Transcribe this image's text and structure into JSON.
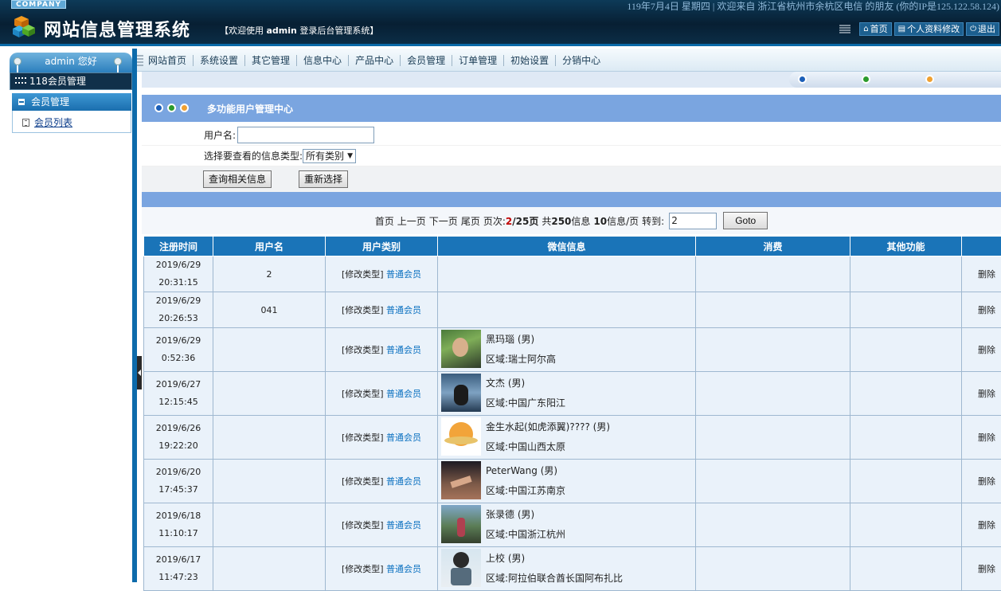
{
  "header": {
    "company": "COMPANY",
    "top_info": "119年7月4日  星期四 | 欢迎来自 浙江省杭州市余杭区电信 的朋友 (你的IP是125.122.58.124)",
    "title": "网站信息管理系统",
    "welcome_prefix": "【欢迎使用",
    "welcome_user": "admin",
    "welcome_suffix": "登录后台管理系统】",
    "buttons": {
      "home": "首页",
      "profile": "个人资料修改",
      "logout": "退出"
    }
  },
  "nav": {
    "items": [
      "网站首页",
      "系统设置",
      "其它管理",
      "信息中心",
      "产品中心",
      "会员管理",
      "订单管理",
      "初始设置",
      "分销中心"
    ]
  },
  "sidebar": {
    "greeting": "admin 您好",
    "section": "118会员管理",
    "group": "会员管理",
    "sub_item": "会员列表"
  },
  "panel": {
    "title": "多功能用户管理中心"
  },
  "form": {
    "username_label": "用户名:",
    "username_value": "",
    "type_label": "选择要查看的信息类型:",
    "type_selected": "所有类别",
    "query_button": "查询相关信息",
    "reset_button": "重新选择"
  },
  "pager": {
    "first": "首页",
    "prev": "上一页",
    "next": "下一页",
    "last": "尾页",
    "page_label": "页次:",
    "current_page": "2",
    "total_pages": "/25页",
    "total_prefix": "共",
    "total_count": "250",
    "total_suffix": "信息",
    "per_page": "10",
    "per_page_suffix": "信息/页",
    "goto_label": "转到:",
    "goto_value": "2",
    "goto_button": "Goto"
  },
  "table": {
    "headers": [
      "注册时间",
      "用户名",
      "用户类别",
      "微信信息",
      "消费",
      "其他功能",
      ""
    ],
    "type_modify": "[修改类型]",
    "delete": "删除",
    "rows": [
      {
        "date": "2019/6/29",
        "time": "20:31:15",
        "username": "2",
        "type": "普通会员",
        "wx_name": "",
        "wx_region": "",
        "avatar": ""
      },
      {
        "date": "2019/6/29",
        "time": "20:26:53",
        "username": "041",
        "type": "普通会员",
        "wx_name": "",
        "wx_region": "",
        "avatar": ""
      },
      {
        "date": "2019/6/29",
        "time": "0:52:36",
        "username": "",
        "type": "普通会员",
        "wx_name": "黑玛瑙 (男)",
        "wx_region": "区域:瑞士阿尔高",
        "avatar": "av1"
      },
      {
        "date": "2019/6/27",
        "time": "12:15:45",
        "username": "",
        "type": "普通会员",
        "wx_name": "文杰 (男)",
        "wx_region": "区域:中国广东阳江",
        "avatar": "av2"
      },
      {
        "date": "2019/6/26",
        "time": "19:22:20",
        "username": "",
        "type": "普通会员",
        "wx_name": "金生水起(如虎添翼)???? (男)",
        "wx_region": "区域:中国山西太原",
        "avatar": "av3"
      },
      {
        "date": "2019/6/20",
        "time": "17:45:37",
        "username": "",
        "type": "普通会员",
        "wx_name": "PeterWang (男)",
        "wx_region": "区域:中国江苏南京",
        "avatar": "av4"
      },
      {
        "date": "2019/6/18",
        "time": "11:10:17",
        "username": "",
        "type": "普通会员",
        "wx_name": "张录德 (男)",
        "wx_region": "区域:中国浙江杭州",
        "avatar": "av5"
      },
      {
        "date": "2019/6/17",
        "time": "11:47:23",
        "username": "",
        "type": "普通会员",
        "wx_name": "上校 (男)",
        "wx_region": "区域:阿拉伯联合酋长国阿布扎比",
        "avatar": "av6"
      }
    ]
  },
  "colors": {
    "header_bg": "#071f33",
    "accent_blue": "#1a74b8",
    "panel_blue": "#7aa5e0",
    "link_blue": "#0a70c0",
    "row_bg": "#eaf2fa"
  }
}
